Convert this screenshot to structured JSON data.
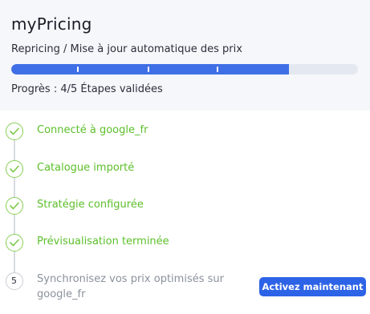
{
  "app": {
    "title": "myPricing",
    "subtitle": "Repricing / Mise à jour automatique des prix"
  },
  "progress": {
    "label": "Progrès : 4/5 Étapes validées",
    "completed": 4,
    "total": 5,
    "fraction": 0.8,
    "color": "#3f6fe6"
  },
  "steps": [
    {
      "label": "Connecté à google_fr",
      "status": "done",
      "icon": "check-icon"
    },
    {
      "label": "Catalogue importé",
      "status": "done",
      "icon": "check-icon"
    },
    {
      "label": "Stratégie configurée",
      "status": "done",
      "icon": "check-icon"
    },
    {
      "label": "Prévisualisation terminée",
      "status": "done",
      "icon": "check-icon"
    },
    {
      "number": "5",
      "label": "Synchronisez vos prix optimisés sur google_fr",
      "status": "pending"
    }
  ],
  "cta": {
    "label": "Activez maintenant"
  },
  "colors": {
    "done": "#5cbf2a",
    "pending": "#8b919c",
    "button": "#2d63e6"
  }
}
